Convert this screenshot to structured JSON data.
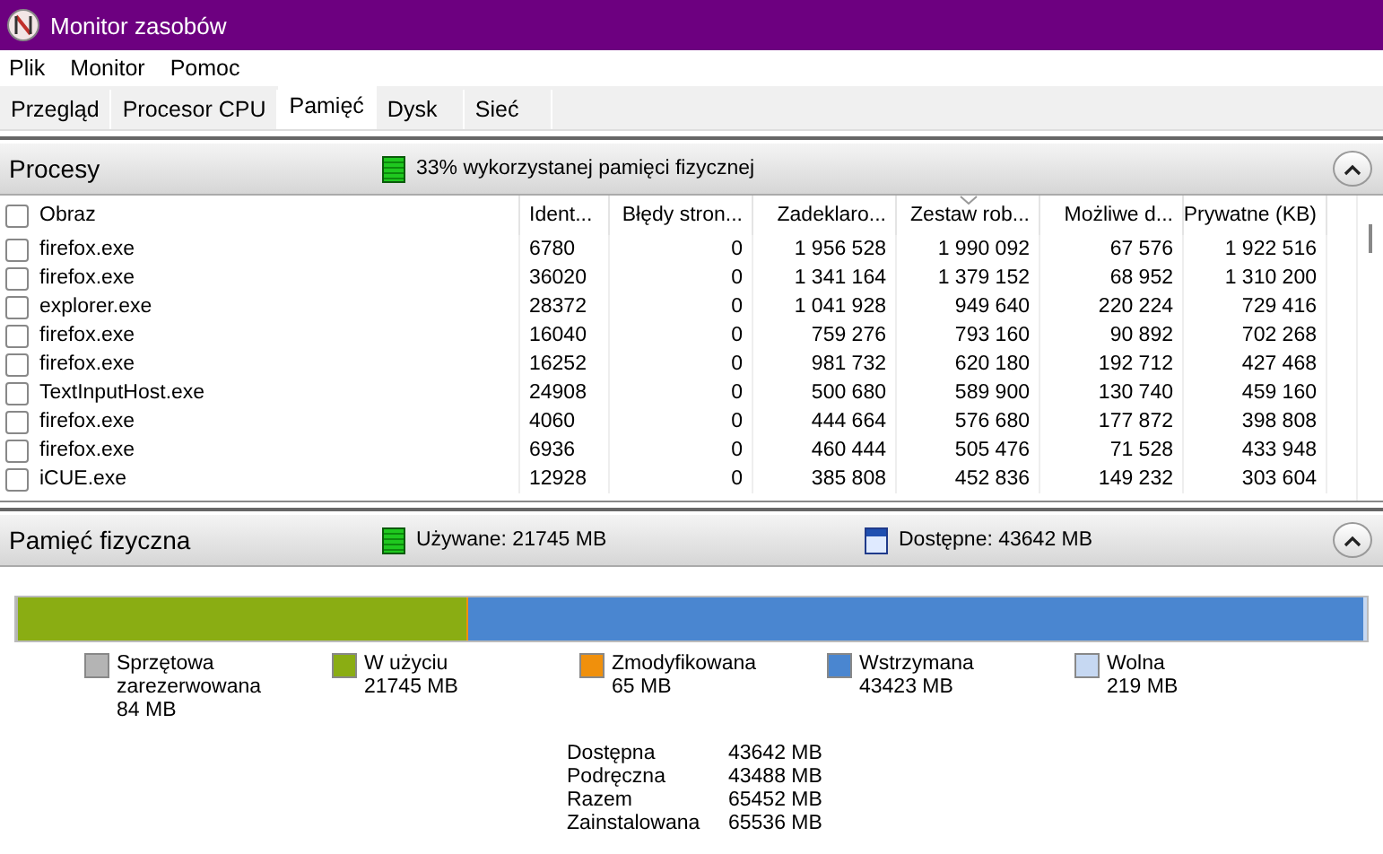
{
  "window": {
    "title": "Monitor zasobów"
  },
  "menu": [
    "Plik",
    "Monitor",
    "Pomoc"
  ],
  "tabs": [
    {
      "label": "Przegląd",
      "selected": false
    },
    {
      "label": "Procesor CPU",
      "selected": false
    },
    {
      "label": "Pamięć",
      "selected": true
    },
    {
      "label": "Dysk",
      "selected": false
    },
    {
      "label": "Sieć",
      "selected": false
    }
  ],
  "processes": {
    "title": "Procesy",
    "summary": "33% wykorzystanej pamięci fizycznej",
    "all_checked": false,
    "columns": [
      {
        "label": "Obraz",
        "sorted": false
      },
      {
        "label": "Ident...",
        "sorted": false
      },
      {
        "label": "Błędy stron...",
        "sorted": false
      },
      {
        "label": "Zadeklaro...",
        "sorted": false
      },
      {
        "label": "Zestaw rob...",
        "sorted": true
      },
      {
        "label": "Możliwe d...",
        "sorted": false
      },
      {
        "label": "Prywatne (KB)",
        "sorted": false
      }
    ],
    "rows": [
      {
        "checked": false,
        "cells": [
          "firefox.exe",
          "6780",
          "0",
          "1 956 528",
          "1 990 092",
          "67 576",
          "1 922 516"
        ]
      },
      {
        "checked": false,
        "cells": [
          "firefox.exe",
          "36020",
          "0",
          "1 341 164",
          "1 379 152",
          "68 952",
          "1 310 200"
        ]
      },
      {
        "checked": false,
        "cells": [
          "explorer.exe",
          "28372",
          "0",
          "1 041 928",
          "949 640",
          "220 224",
          "729 416"
        ]
      },
      {
        "checked": false,
        "cells": [
          "firefox.exe",
          "16040",
          "0",
          "759 276",
          "793 160",
          "90 892",
          "702 268"
        ]
      },
      {
        "checked": false,
        "cells": [
          "firefox.exe",
          "16252",
          "0",
          "981 732",
          "620 180",
          "192 712",
          "427 468"
        ]
      },
      {
        "checked": false,
        "cells": [
          "TextInputHost.exe",
          "24908",
          "0",
          "500 680",
          "589 900",
          "130 740",
          "459 160"
        ]
      },
      {
        "checked": false,
        "cells": [
          "firefox.exe",
          "4060",
          "0",
          "444 664",
          "576 680",
          "177 872",
          "398 808"
        ]
      },
      {
        "checked": false,
        "cells": [
          "firefox.exe",
          "6936",
          "0",
          "460 444",
          "505 476",
          "71 528",
          "433 948"
        ]
      },
      {
        "checked": false,
        "cells": [
          "iCUE.exe",
          "12928",
          "0",
          "385 808",
          "452 836",
          "149 232",
          "303 604"
        ]
      }
    ]
  },
  "memory": {
    "title": "Pamięć fizyczna",
    "used": "Używane: 21745 MB",
    "available": "Dostępne: 43642 MB",
    "legend": [
      {
        "label": "Sprzętowa zarezerwowana",
        "value": "84 MB",
        "color": "#b4b4b4",
        "level": 0.0013
      },
      {
        "label": "W użyciu",
        "value": "21745 MB",
        "color": "#8aad13",
        "level": 0.3318
      },
      {
        "label": "Zmodyfikowana",
        "value": "65 MB",
        "color": "#f0900c",
        "level": 0.001
      },
      {
        "label": "Wstrzymana",
        "value": "43423 MB",
        "color": "#4a86d0",
        "level": 0.6626
      },
      {
        "label": "Wolna",
        "value": "219 MB",
        "color": "#c6d8f2",
        "level": 0.0033
      }
    ],
    "totals": [
      {
        "label": "Dostępna",
        "value": "43642 MB"
      },
      {
        "label": "Podręczna",
        "value": "43488 MB"
      },
      {
        "label": "Razem",
        "value": "65452 MB"
      },
      {
        "label": "Zainstalowana",
        "value": "65536 MB"
      }
    ]
  }
}
